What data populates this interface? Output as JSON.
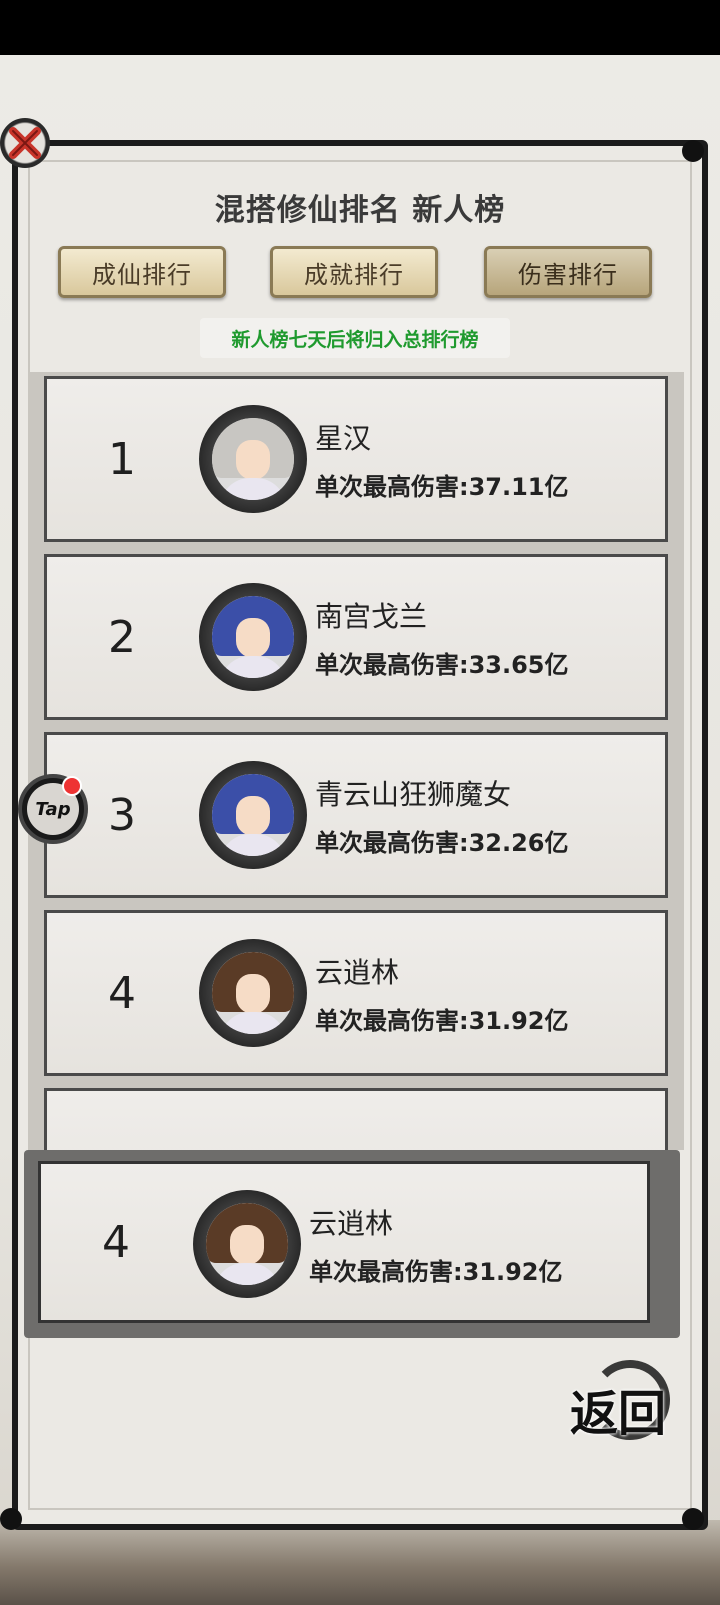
{
  "header": {
    "title": "混搭修仙排名 新人榜",
    "notice": "新人榜七天后将归入总排行榜"
  },
  "tabs": [
    {
      "label": "成仙排行",
      "active": false
    },
    {
      "label": "成就排行",
      "active": false
    },
    {
      "label": "伤害排行",
      "active": true
    }
  ],
  "leaderboard": [
    {
      "rank": "1",
      "name": "星汉",
      "damage": "单次最高伤害:37.11亿",
      "hair": "silver"
    },
    {
      "rank": "2",
      "name": "南宫戈兰",
      "damage": "单次最高伤害:33.65亿",
      "hair": "blue"
    },
    {
      "rank": "3",
      "name": "青云山狂狮魔女",
      "damage": "单次最高伤害:32.26亿",
      "hair": "blue"
    },
    {
      "rank": "4",
      "name": "云逍林",
      "damage": "单次最高伤害:31.92亿",
      "hair": "brown"
    }
  ],
  "my_entry": {
    "rank": "4",
    "name": "云逍林",
    "damage": "单次最高伤害:31.92亿",
    "hair": "brown"
  },
  "buttons": {
    "back_label": "返回",
    "tap_label": "Tap"
  },
  "colors": {
    "notice_green": "#1f9a2e",
    "notification_dot": "#e33"
  }
}
